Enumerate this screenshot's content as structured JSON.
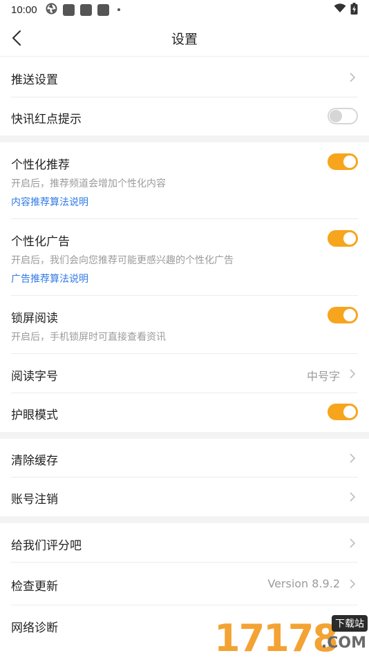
{
  "status_bar": {
    "time": "10:00"
  },
  "navbar": {
    "title": "设置"
  },
  "section1": {
    "push": {
      "label": "推送设置"
    },
    "flash_dot": {
      "label": "快讯红点提示",
      "enabled": false
    }
  },
  "section2": {
    "personalized_rec": {
      "label": "个性化推荐",
      "desc": "开启后，推荐频道会增加个性化内容",
      "link": "内容推荐算法说明",
      "enabled": true
    },
    "personalized_ads": {
      "label": "个性化广告",
      "desc": "开启后，我们会向您推荐可能更感兴趣的个性化广告",
      "link": "广告推荐算法说明",
      "enabled": true
    },
    "lock_read": {
      "label": "锁屏阅读",
      "desc": "开启后，手机锁屏时可直接查看资讯",
      "enabled": true
    },
    "font_size": {
      "label": "阅读字号",
      "value": "中号字"
    },
    "eye_mode": {
      "label": "护眼模式",
      "enabled": true
    }
  },
  "section3": {
    "clear_cache": {
      "label": "清除缓存"
    },
    "delete_account": {
      "label": "账号注销"
    }
  },
  "section4": {
    "rate_us": {
      "label": "给我们评分吧"
    },
    "check_update": {
      "label": "检查更新",
      "value": "Version 8.9.2"
    },
    "network": {
      "label": "网络诊断"
    }
  },
  "watermark": {
    "digits": "17178",
    "badge": "下载站",
    "domain": ".COM"
  },
  "colors": {
    "accent": "#f7a51c",
    "link": "#2f7ae5",
    "muted": "#9b9b9b",
    "divider_bg": "#f3f3f3"
  }
}
